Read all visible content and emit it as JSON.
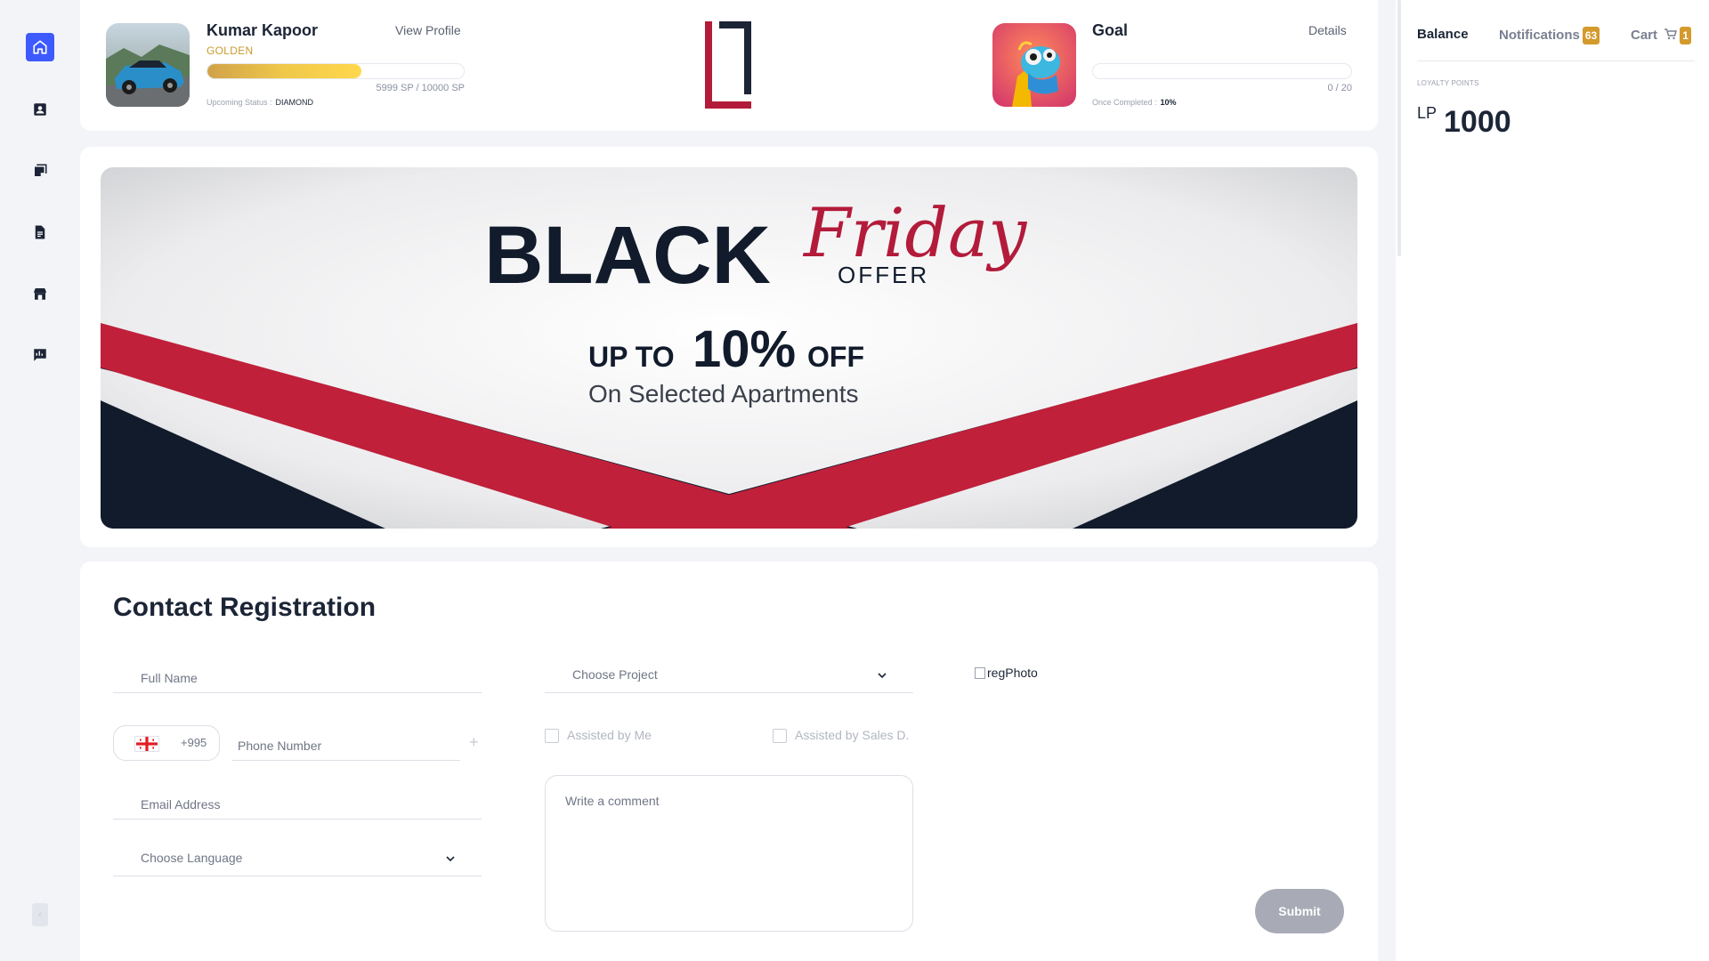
{
  "sidebar": {
    "items": [
      {
        "icon": "home-icon",
        "active": true
      },
      {
        "icon": "contact-card-icon",
        "active": false
      },
      {
        "icon": "sticky-note-icon",
        "active": false
      },
      {
        "icon": "document-icon",
        "active": false
      },
      {
        "icon": "store-icon",
        "active": false
      },
      {
        "icon": "chat-report-icon",
        "active": false
      }
    ],
    "collapse_label": "‹"
  },
  "profile": {
    "name": "Kumar Kapoor",
    "view_profile": "View Profile",
    "tier": "GOLDEN",
    "progress_fraction": 0.5999,
    "sp_text": "5999 SP  /  10000 SP",
    "upcoming_status_label": "Upcoming Status :",
    "upcoming_status_value": "DIAMOND"
  },
  "goal": {
    "title": "Goal",
    "details_label": "Details",
    "count_text": "0  /  20",
    "completed_label": "Once Completed :",
    "completed_value": "10%"
  },
  "banner": {
    "line1": "BLACK",
    "script": "Friday",
    "offer": "OFFER",
    "up_to": "UP TO",
    "percent": "10%",
    "off": "OFF",
    "subtitle": "On Selected Apartments",
    "colors": {
      "red": "#c0203a",
      "navy": "#111b2b"
    }
  },
  "right_panel": {
    "tabs": {
      "balance": "Balance",
      "notifications": "Notifications",
      "cart": "Cart"
    },
    "notifications_count": "63",
    "cart_count": "1",
    "loyalty_label": "LOYALTY POINTS",
    "currency": "LP",
    "points": "1000"
  },
  "form": {
    "title": "Contact Registration",
    "full_name_placeholder": "Full Name",
    "phone_code": "+995",
    "phone_placeholder": "Phone Number",
    "plus": "+",
    "email_placeholder": "Email Address",
    "language_placeholder": "Choose Language",
    "project_placeholder": "Choose Project",
    "assisted_me": "Assisted by Me",
    "assisted_sales": "Assisted by Sales D.",
    "comment_placeholder": "Write a comment",
    "reg_photo_alt": "regPhoto",
    "submit": "Submit"
  },
  "colors": {
    "accent": "#3d5afe",
    "gold": "#d49a2c",
    "brand_red": "#b31b3a"
  }
}
